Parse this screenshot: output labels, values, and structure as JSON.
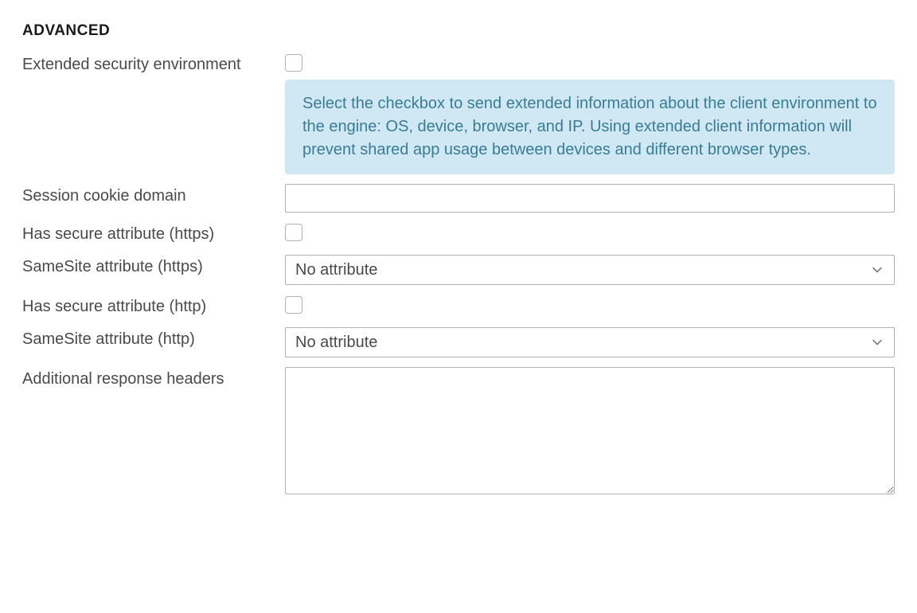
{
  "section": {
    "heading": "ADVANCED"
  },
  "fields": {
    "extended_security": {
      "label": "Extended security environment",
      "checked": false,
      "info": "Select the checkbox to send extended information about the client environment to the engine: OS, device, browser, and IP. Using extended client information will prevent shared app usage between devices and different browser types."
    },
    "session_cookie_domain": {
      "label": "Session cookie domain",
      "value": ""
    },
    "has_secure_https": {
      "label": "Has secure attribute (https)",
      "checked": false
    },
    "samesite_https": {
      "label": "SameSite attribute (https)",
      "value": "No attribute"
    },
    "has_secure_http": {
      "label": "Has secure attribute (http)",
      "checked": false
    },
    "samesite_http": {
      "label": "SameSite attribute (http)",
      "value": "No attribute"
    },
    "additional_response_headers": {
      "label": "Additional response headers",
      "value": ""
    }
  }
}
